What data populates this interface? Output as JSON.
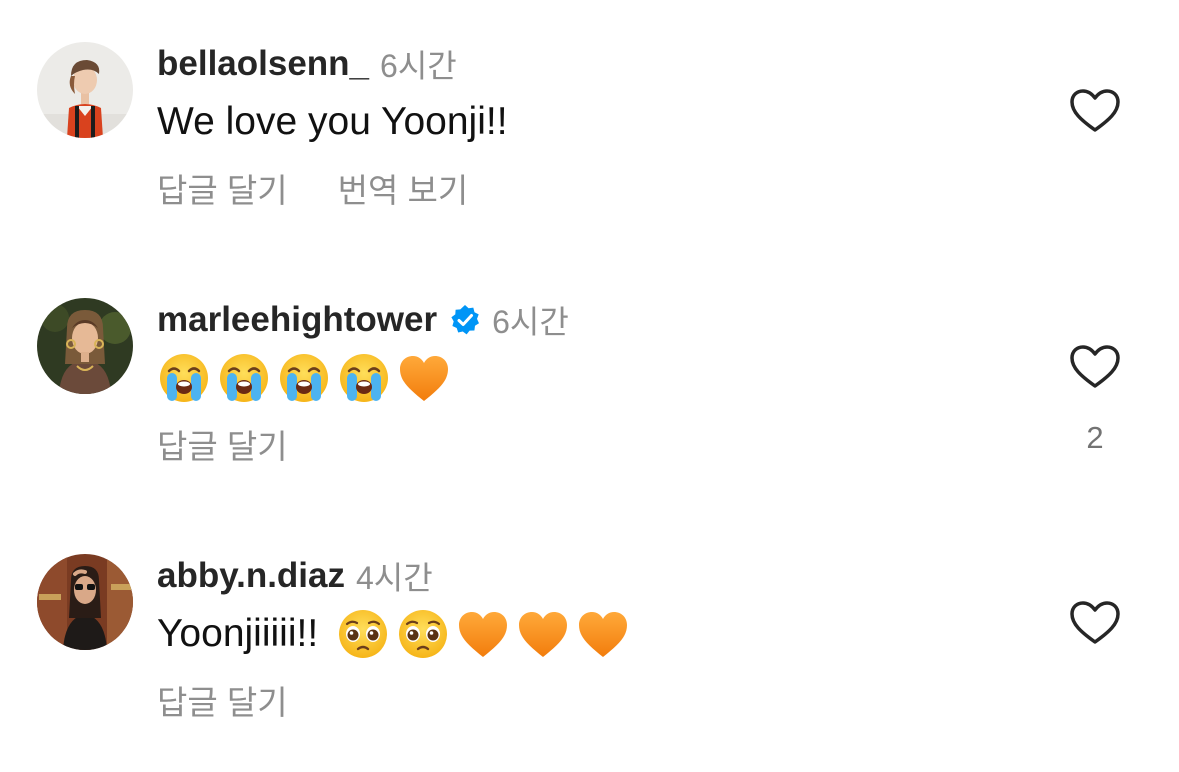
{
  "comments": [
    {
      "username": "bellaolsenn_",
      "verified": false,
      "time": "6시간",
      "text": "We love you Yoonji!!",
      "emojis": [],
      "actions": [
        "답글 달기",
        "번역 보기"
      ],
      "likes": ""
    },
    {
      "username": "marleehightower",
      "verified": true,
      "time": "6시간",
      "text": "",
      "emojis": [
        "loudly-crying-face",
        "loudly-crying-face",
        "loudly-crying-face",
        "loudly-crying-face",
        "orange-heart"
      ],
      "actions": [
        "답글 달기"
      ],
      "likes": "2"
    },
    {
      "username": "abby.n.diaz",
      "verified": false,
      "time": "4시간",
      "text": "Yoonjiiiii!!",
      "emojis": [
        "pleading-face",
        "pleading-face",
        "orange-heart",
        "orange-heart",
        "orange-heart"
      ],
      "actions": [
        "답글 달기"
      ],
      "likes": ""
    }
  ],
  "colors": {
    "username": "#262626",
    "meta": "#8e8e8e",
    "verified": "#0095f6",
    "heart_outline": "#262626",
    "orange_heart": "#f78c1f"
  }
}
